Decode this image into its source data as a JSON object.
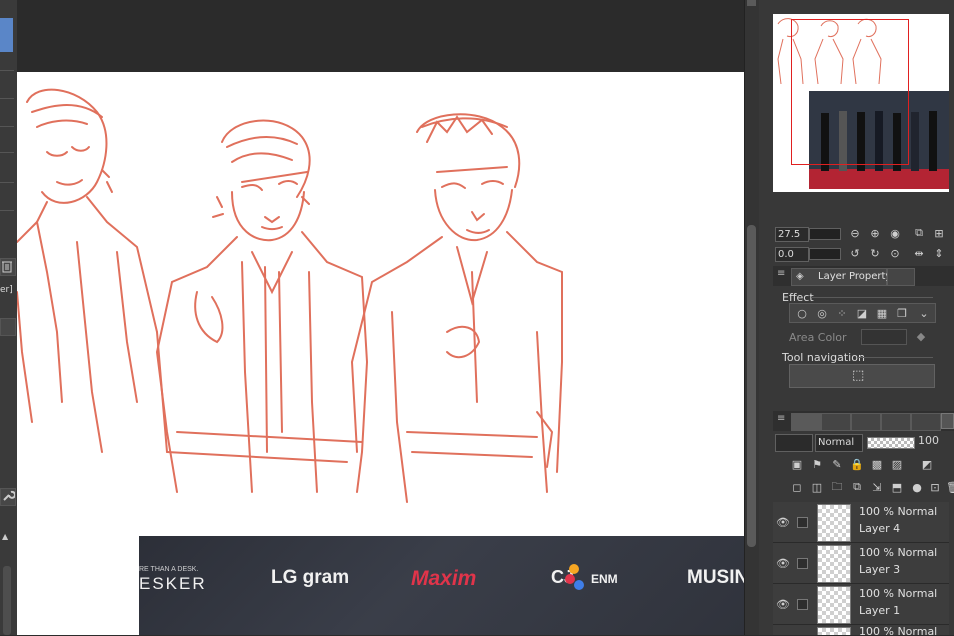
{
  "icons": {
    "zoom_out": "zoom-out-icon",
    "zoom_in": "zoom-in-icon",
    "fit": "fit-icon",
    "rotate_left": "rotate-left-icon",
    "rotate_right": "rotate-right-icon",
    "reset_rotation": "reset-rotation-icon",
    "flip_h": "flip-horizontal-icon",
    "flip_v": "flip-vertical-icon",
    "eye": "eye-icon",
    "trash": "trash-icon",
    "wrench": "wrench-icon",
    "cursor_cube": "tool-navigation-icon"
  },
  "colors": {
    "sketch": "#e0705c",
    "nav_frame": "#e02020",
    "accent_blue": "#5a86c8"
  },
  "canvas": {
    "banner": {
      "logo1": "RE THAN A DESK.",
      "logo1b": "ESKER",
      "logo2": "LG gram",
      "logo3": "Maxim",
      "logo4": "CJ",
      "logo4b": "ENM",
      "logo5": "MUSIN"
    }
  },
  "navigator": {
    "zoom_value": "27.5",
    "rotate_value": "0.0"
  },
  "layer_property": {
    "tab_label": "Layer Property",
    "effect_label": "Effect",
    "area_color_label": "Area Color",
    "tool_navigation_label": "Tool navigation"
  },
  "layers_toolbar": {
    "blend_mode": "Normal",
    "opacity": "100"
  },
  "layers": [
    {
      "blend": "100 % Normal",
      "name": "Layer 4"
    },
    {
      "blend": "100 % Normal",
      "name": "Layer 3"
    },
    {
      "blend": "100 % Normal",
      "name": "Layer 1"
    },
    {
      "blend": "100 % Normal",
      "name": ""
    }
  ],
  "left_strip": {
    "partial_label": "er]"
  }
}
